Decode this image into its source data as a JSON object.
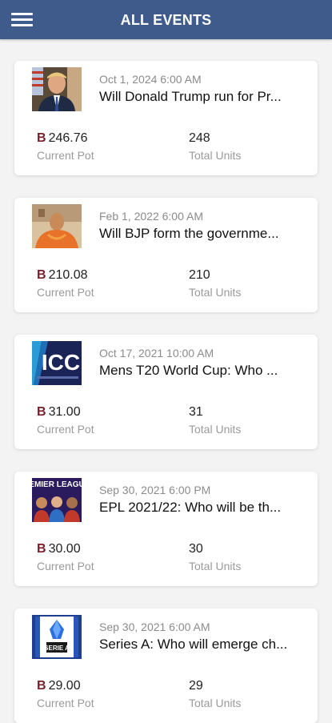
{
  "header": {
    "title": "ALL EVENTS",
    "menu_icon": "hamburger-menu-icon"
  },
  "events": [
    {
      "thumbnail": "trump-portrait-image",
      "date": "Oct 1, 2024 6:00 AM",
      "title": "Will Donald Trump run for Pr...",
      "currency": "B",
      "pot": "246.76",
      "pot_label": "Current Pot",
      "units": "248",
      "units_label": "Total Units"
    },
    {
      "thumbnail": "bjp-leader-portrait-image",
      "date": "Feb 1, 2022 6:00 AM",
      "title": "Will BJP form the governme...",
      "currency": "B",
      "pot": "210.08",
      "pot_label": "Current Pot",
      "units": "210",
      "units_label": "Total Units"
    },
    {
      "thumbnail": "icc-logo-image",
      "date": "Oct 17, 2021 10:00 AM",
      "title": "Mens T20 World Cup: Who ...",
      "currency": "B",
      "pot": "31.00",
      "pot_label": "Current Pot",
      "units": "31",
      "units_label": "Total Units",
      "thumb_text": "ICC"
    },
    {
      "thumbnail": "premier-league-image",
      "date": "Sep 30, 2021 6:00 PM",
      "title": "EPL 2021/22: Who will be th...",
      "currency": "B",
      "pot": "30.00",
      "pot_label": "Current Pot",
      "units": "30",
      "units_label": "Total Units",
      "thumb_text": "EMIER LEAGU"
    },
    {
      "thumbnail": "serie-a-logo-image",
      "date": "Sep 30, 2021 6:00 AM",
      "title": "Series A: Who will emerge ch...",
      "currency": "B",
      "pot": "29.00",
      "pot_label": "Current Pot",
      "units": "29",
      "units_label": "Total Units",
      "thumb_text": "SERIE A"
    }
  ],
  "colors": {
    "appbar": "#3f5b8c",
    "currency": "#7a1f2b",
    "background": "#f3f3f3"
  }
}
